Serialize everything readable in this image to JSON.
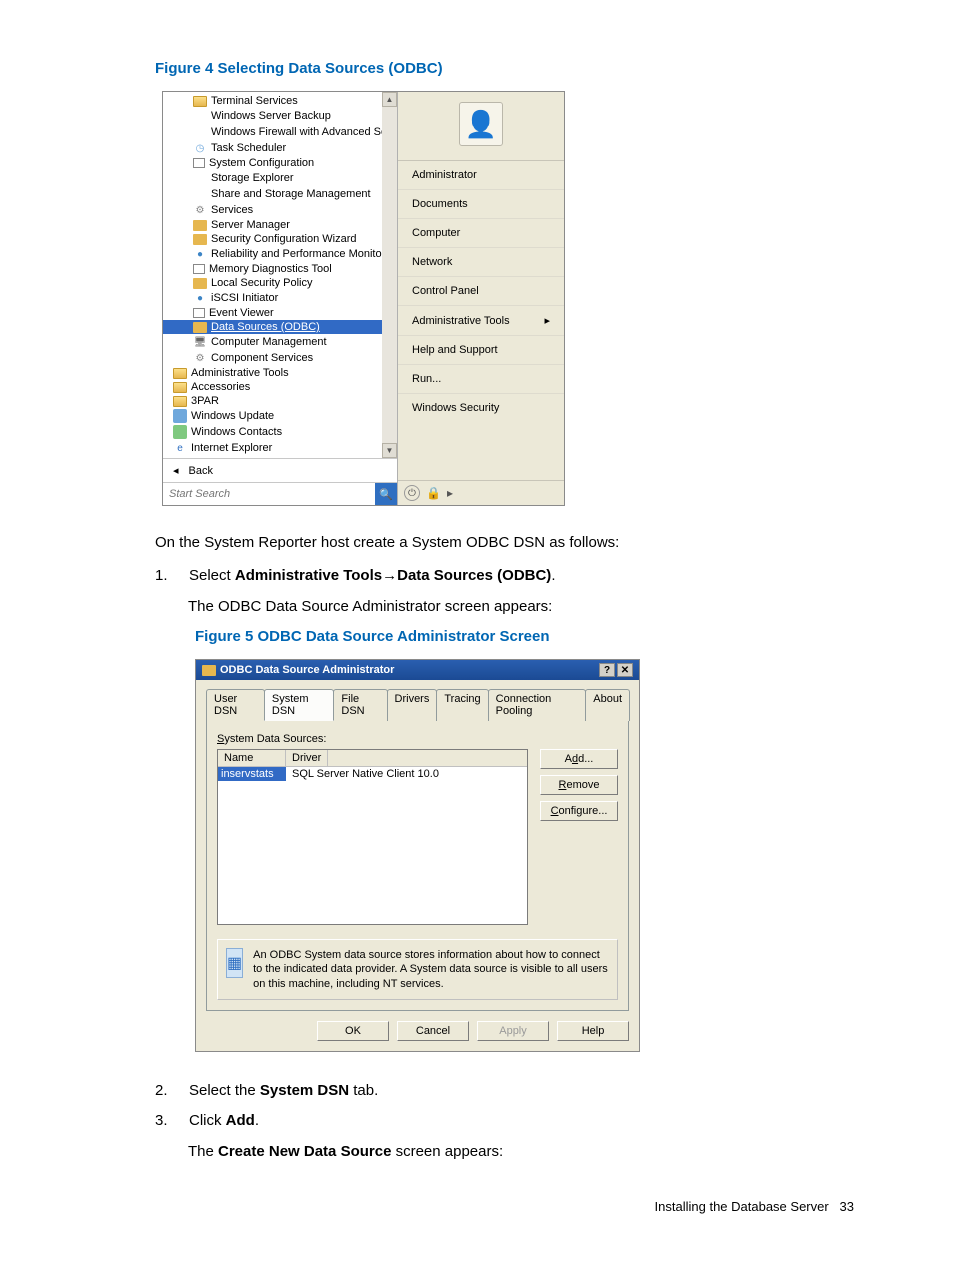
{
  "figure4": {
    "caption": "Figure 4 Selecting Data Sources (ODBC)",
    "left_items": [
      {
        "label": "Internet Explorer",
        "icon": "i-ie",
        "ch": "e"
      },
      {
        "label": "Windows Contacts",
        "icon": "i-green",
        "ch": ""
      },
      {
        "label": "Windows Update",
        "icon": "i-blue",
        "ch": ""
      },
      {
        "label": "3PAR",
        "icon": "i-folder",
        "ch": ""
      },
      {
        "label": "Accessories",
        "icon": "i-folder",
        "ch": ""
      },
      {
        "label": "Administrative Tools",
        "icon": "i-folder",
        "ch": ""
      },
      {
        "label": "Component Services",
        "icon": "i-gear",
        "ch": "⚙",
        "indent": true
      },
      {
        "label": "Computer Management",
        "icon": "i-pc",
        "ch": "🖥",
        "indent": true
      },
      {
        "label": "Data Sources (ODBC)",
        "icon": "i-admin",
        "ch": "",
        "indent": true,
        "selected": true
      },
      {
        "label": "Event Viewer",
        "icon": "i-mem",
        "ch": "",
        "indent": true
      },
      {
        "label": "iSCSI Initiator",
        "icon": "i-globe",
        "ch": "●",
        "indent": true
      },
      {
        "label": "Local Security Policy",
        "icon": "i-admin",
        "ch": "",
        "indent": true
      },
      {
        "label": "Memory Diagnostics Tool",
        "icon": "i-mem",
        "ch": "",
        "indent": true
      },
      {
        "label": "Reliability and Performance Monitor",
        "icon": "i-globe",
        "ch": "●",
        "indent": true
      },
      {
        "label": "Security Configuration Wizard",
        "icon": "i-admin",
        "ch": "",
        "indent": true
      },
      {
        "label": "Server Manager",
        "icon": "i-admin",
        "ch": "",
        "indent": true
      },
      {
        "label": "Services",
        "icon": "i-gear",
        "ch": "⚙",
        "indent": true
      },
      {
        "label": "Share and Storage Management",
        "icon": "i-storage",
        "ch": "",
        "indent": true
      },
      {
        "label": "Storage Explorer",
        "icon": "i-storage",
        "ch": "",
        "indent": true
      },
      {
        "label": "System Configuration",
        "icon": "i-sys",
        "ch": "",
        "indent": true
      },
      {
        "label": "Task Scheduler",
        "icon": "i-sched",
        "ch": "◷",
        "indent": true
      },
      {
        "label": "Windows Firewall with Advanced Securit",
        "icon": "i-fire",
        "ch": "",
        "indent": true
      },
      {
        "label": "Windows Server Backup",
        "icon": "i-backup",
        "ch": "",
        "indent": true
      },
      {
        "label": "Terminal Services",
        "icon": "i-folder",
        "ch": "",
        "indent": true
      }
    ],
    "back_label": "Back",
    "search_placeholder": "Start Search",
    "right_user": "Administrator",
    "right_items": [
      {
        "label": "Documents"
      },
      {
        "label": "Computer"
      },
      {
        "label": "Network"
      },
      {
        "label": "Control Panel"
      },
      {
        "label": "Administrative Tools",
        "arrow": true
      },
      {
        "label": "Help and Support"
      },
      {
        "label": "Run..."
      },
      {
        "label": "Windows Security"
      }
    ]
  },
  "intro_text": "On the System Reporter host create a System ODBC DSN as follows:",
  "step1": {
    "num": "1.",
    "prefix": "Select ",
    "bold1": "Administrative Tools",
    "arrow": "→",
    "bold2": "Data Sources (ODBC)",
    "suffix": ".",
    "sub": "The ODBC Data Source Administrator screen appears:"
  },
  "figure5": {
    "caption": "Figure 5 ODBC Data Source Administrator Screen",
    "title": "ODBC Data Source Administrator",
    "tabs": [
      "User DSN",
      "System DSN",
      "File DSN",
      "Drivers",
      "Tracing",
      "Connection Pooling",
      "About"
    ],
    "active_tab": 1,
    "panel_label": "System Data Sources:",
    "col1": "Name",
    "col2": "Driver",
    "row_name": "inservstats",
    "row_driver": "SQL Server Native Client 10.0",
    "btn_add": "Add...",
    "btn_remove": "Remove",
    "btn_configure": "Configure...",
    "info_text": "An ODBC System data source stores information about how to connect to the indicated data provider.   A System data source is visible to all users on this machine, including NT services.",
    "btn_ok": "OK",
    "btn_cancel": "Cancel",
    "btn_apply": "Apply",
    "btn_help": "Help"
  },
  "step2": {
    "num": "2.",
    "prefix": "Select the ",
    "bold": "System DSN",
    "suffix": " tab."
  },
  "step3": {
    "num": "3.",
    "prefix": "Click ",
    "bold": "Add",
    "suffix": ".",
    "sub_prefix": "The ",
    "sub_bold": "Create New Data Source",
    "sub_suffix": " screen appears:"
  },
  "footer": {
    "text": "Installing the Database Server",
    "page": "33"
  }
}
